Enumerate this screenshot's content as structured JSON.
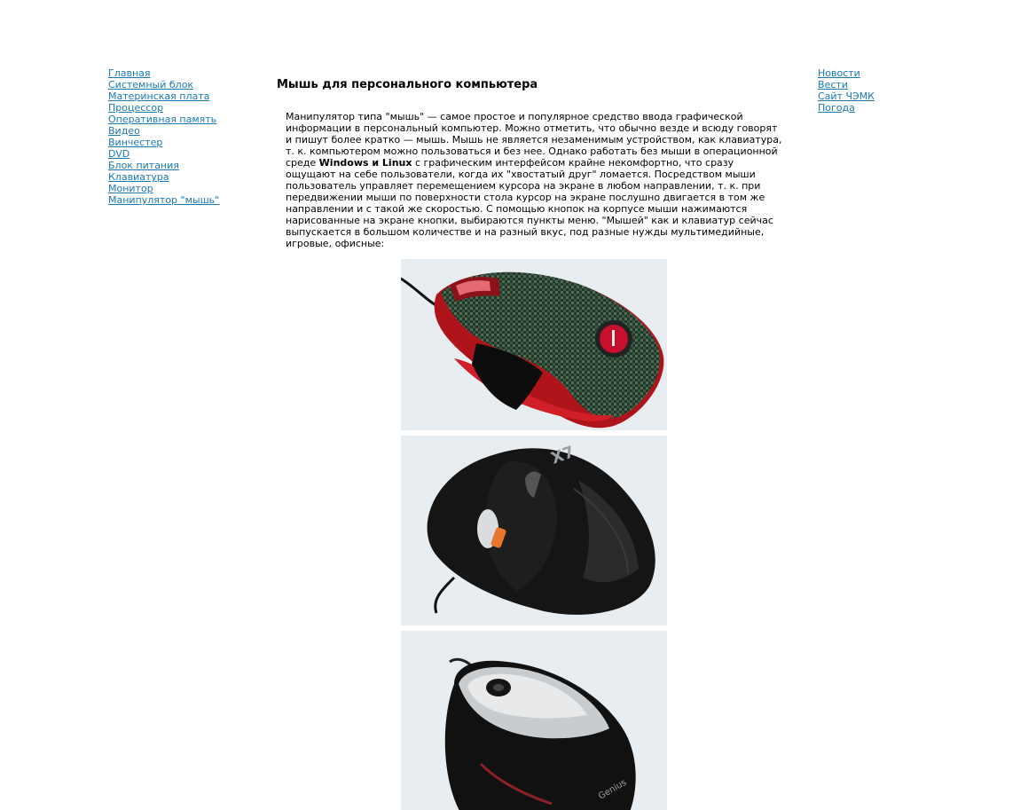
{
  "left_nav": [
    "Главная",
    "Системный блок",
    "Материнская плата",
    "Процессор",
    "Оперативная память",
    "Видео",
    "Винчестер",
    "DVD",
    "Блок питания",
    "Клавиатура",
    "Монитор",
    "Манипулятор \"мышь\""
  ],
  "right_nav": [
    "Новости",
    "Вести",
    "Сайт ЧЭМК",
    "Погода"
  ],
  "title": "Мышь для персонального компьютера",
  "article": {
    "part1": "Манипулятор типа \"мышь\" — самое простое и популярное средство ввода графической информации в персональный компьютер. Можно отметить, что обычно везде и всюду говорят и пишут более кратко — мышь. Мышь не является незаменимым устройством, как клавиатура, т. к. компьютером можно пользоваться и без нее. Однако работать без мыши в операционной среде ",
    "bold": "Windows и Linux",
    "part2": " с графическим интерфейсом крайне некомфортно, что сразу ощущают на себе пользователи, когда их \"хвостатый друг\" ломается. Посредством мыши пользователь управляет перемещением курсора на экране в любом направлении, т. к. при передвижении мыши по поверхности стола курсор на экране послушно двигается в том же направлении и с такой же скоростью. С помощью кнопок на корпусе мыши нажимаются нарисованные на экране кнопки, выбираются пункты меню. \"Мышей\" как и клавиатур сейчас выпускается в большом количестве и на разный вкус, под разные нужды мультимедийные, игровые, офисные:"
  },
  "photo_logos": {
    "mouse2": "X7",
    "mouse3": "Genius"
  }
}
